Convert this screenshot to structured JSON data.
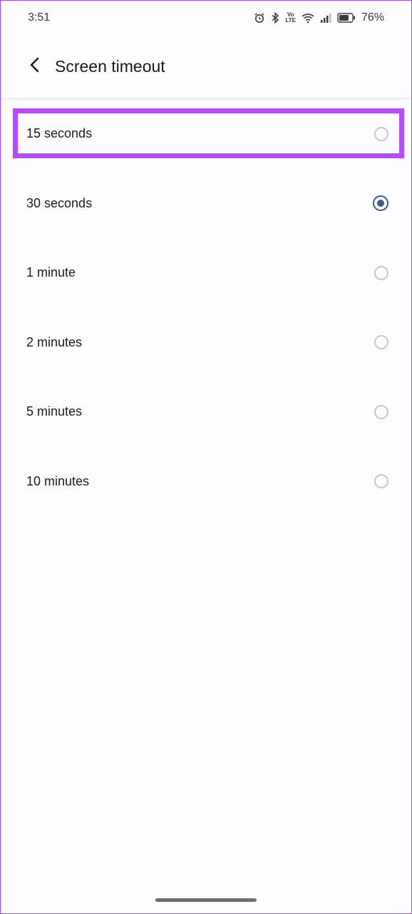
{
  "status_bar": {
    "time": "3:51",
    "battery_percent": "76%",
    "battery_level": 0.76,
    "network_badge_top": "Vo",
    "network_badge_bottom": "LTE"
  },
  "header": {
    "title": "Screen timeout"
  },
  "options": [
    {
      "label": "15 seconds",
      "selected": false
    },
    {
      "label": "30 seconds",
      "selected": true
    },
    {
      "label": "1 minute",
      "selected": false
    },
    {
      "label": "2 minutes",
      "selected": false
    },
    {
      "label": "5 minutes",
      "selected": false
    },
    {
      "label": "10 minutes",
      "selected": false
    }
  ],
  "colors": {
    "highlight": "#b44dff",
    "radio_selected": "#3d5a8a"
  }
}
